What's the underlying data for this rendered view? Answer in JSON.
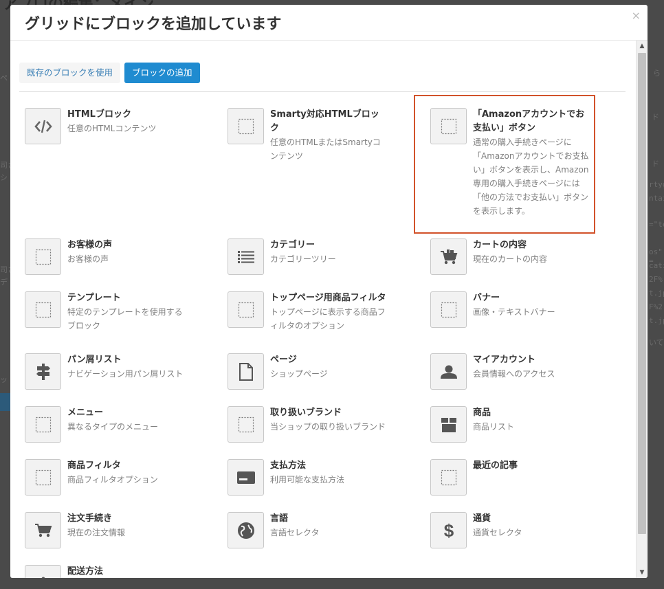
{
  "background": {
    "title": "アプロの編集：メイン",
    "fragments": [
      "ペ",
      "ド",
      "ド",
      "rtygh",
      "ntain",
      "=\"tex",
      "os\" =",
      "catio",
      "2F%",
      "t.jp%",
      "F%2",
      "t.jp%",
      "いて",
      "司さ",
      "シ",
      "司さ",
      "デ",
      "ッ",
      "ら"
    ]
  },
  "modal": {
    "title": "グリッドにブロックを追加しています",
    "close": "×",
    "tabs": {
      "existing": "既存のブロックを使用",
      "add": "ブロックの追加"
    }
  },
  "blocks": [
    {
      "name": "HTMLブロック",
      "desc": "任意のHTMLコンテンツ",
      "icon": "code-icon"
    },
    {
      "name": "Smarty対応HTMLブロック",
      "desc": "任意のHTMLまたはSmartyコンテンツ",
      "icon": "dotted-square-icon"
    },
    {
      "name": "「Amazonアカウントでお支払い」ボタン",
      "desc": "通常の購入手続きページに「Amazonアカウントでお支払い」ボタンを表示し、Amazon専用の購入手続きページには「他の方法でお支払い」ボタンを表示します。",
      "icon": "dotted-square-icon"
    },
    {
      "name": "お客様の声",
      "desc": "お客様の声",
      "icon": "dotted-square-icon"
    },
    {
      "name": "カテゴリー",
      "desc": "カテゴリーツリー",
      "icon": "list-icon"
    },
    {
      "name": "カートの内容",
      "desc": "現在のカートの内容",
      "icon": "cart-items-icon"
    },
    {
      "name": "テンプレート",
      "desc": "特定のテンプレートを使用するブロック",
      "icon": "dotted-square-icon"
    },
    {
      "name": "トップページ用商品フィルタ",
      "desc": "トップページに表示する商品フィルタのオプション",
      "icon": "dotted-square-icon"
    },
    {
      "name": "バナー",
      "desc": "画像・テキストバナー",
      "icon": "dotted-square-icon"
    },
    {
      "name": "パン屑リスト",
      "desc": "ナビゲーション用パン屑リスト",
      "icon": "signpost-icon"
    },
    {
      "name": "ページ",
      "desc": "ショップページ",
      "icon": "page-icon"
    },
    {
      "name": "マイアカウント",
      "desc": "会員情報へのアクセス",
      "icon": "user-icon"
    },
    {
      "name": "メニュー",
      "desc": "異なるタイプのメニュー",
      "icon": "dotted-square-icon"
    },
    {
      "name": "取り扱いブランド",
      "desc": "当ショップの取り扱いブランド",
      "icon": "dotted-square-icon"
    },
    {
      "name": "商品",
      "desc": "商品リスト",
      "icon": "box-icon"
    },
    {
      "name": "商品フィルタ",
      "desc": "商品フィルタオプション",
      "icon": "dotted-square-icon"
    },
    {
      "name": "支払方法",
      "desc": "利用可能な支払方法",
      "icon": "credit-card-icon"
    },
    {
      "name": "最近の記事",
      "desc": "",
      "icon": "dotted-square-icon"
    },
    {
      "name": "注文手続き",
      "desc": "現在の注文情報",
      "icon": "cart-icon"
    },
    {
      "name": "言語",
      "desc": "言語セレクタ",
      "icon": "globe-icon"
    },
    {
      "name": "通貨",
      "desc": "通貨セレクタ",
      "icon": "dollar-icon"
    },
    {
      "name": "配送方法",
      "desc": "",
      "icon": "info-icon"
    }
  ],
  "selected_block": "「Amazonアカウントでお支払い」ボタン",
  "colors": {
    "primary": "#1f8bd0",
    "link": "#3a7fb5",
    "highlight": "#d2522a"
  }
}
